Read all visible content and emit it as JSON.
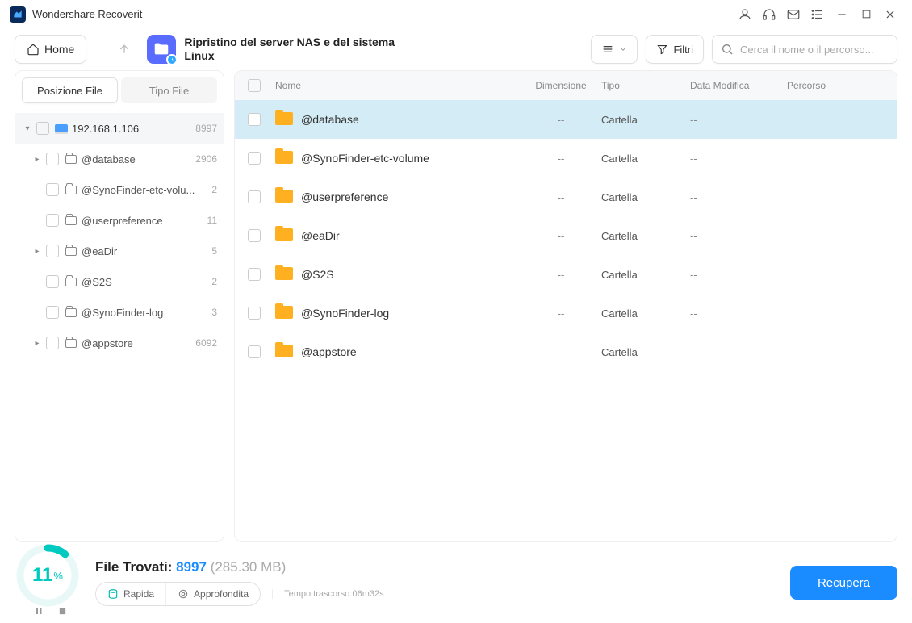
{
  "app": {
    "title": "Wondershare Recoverit"
  },
  "toolbar": {
    "home": "Home",
    "section_title": "Ripristino del server NAS e del sistema Linux",
    "filter": "Filtri",
    "search_placeholder": "Cerca il nome o il percorso..."
  },
  "sidebar": {
    "tabs": {
      "position": "Posizione File",
      "type": "Tipo File"
    },
    "root": {
      "name": "192.168.1.106",
      "count": "8997"
    },
    "items": [
      {
        "name": "@database",
        "count": "2906",
        "expandable": true
      },
      {
        "name": "@SynoFinder-etc-volu...",
        "count": "2",
        "expandable": false
      },
      {
        "name": "@userpreference",
        "count": "11",
        "expandable": false
      },
      {
        "name": "@eaDir",
        "count": "5",
        "expandable": true
      },
      {
        "name": "@S2S",
        "count": "2",
        "expandable": false
      },
      {
        "name": "@SynoFinder-log",
        "count": "3",
        "expandable": false
      },
      {
        "name": "@appstore",
        "count": "6092",
        "expandable": true
      }
    ]
  },
  "table": {
    "headers": {
      "name": "Nome",
      "size": "Dimensione",
      "type": "Tipo",
      "date": "Data Modifica",
      "path": "Percorso"
    },
    "rows": [
      {
        "name": "@database",
        "size": "--",
        "type": "Cartella",
        "date": "--"
      },
      {
        "name": "@SynoFinder-etc-volume",
        "size": "--",
        "type": "Cartella",
        "date": "--"
      },
      {
        "name": "@userpreference",
        "size": "--",
        "type": "Cartella",
        "date": "--"
      },
      {
        "name": "@eaDir",
        "size": "--",
        "type": "Cartella",
        "date": "--"
      },
      {
        "name": "@S2S",
        "size": "--",
        "type": "Cartella",
        "date": "--"
      },
      {
        "name": "@SynoFinder-log",
        "size": "--",
        "type": "Cartella",
        "date": "--"
      },
      {
        "name": "@appstore",
        "size": "--",
        "type": "Cartella",
        "date": "--"
      }
    ]
  },
  "footer": {
    "percent": "11",
    "found_label": "File Trovati: ",
    "found_count": "8997",
    "found_size": " (285.30 MB)",
    "mode_quick": "Rapida",
    "mode_deep": "Approfondita",
    "elapsed": "Tempo trascorso:06m32s",
    "recover": "Recupera"
  }
}
